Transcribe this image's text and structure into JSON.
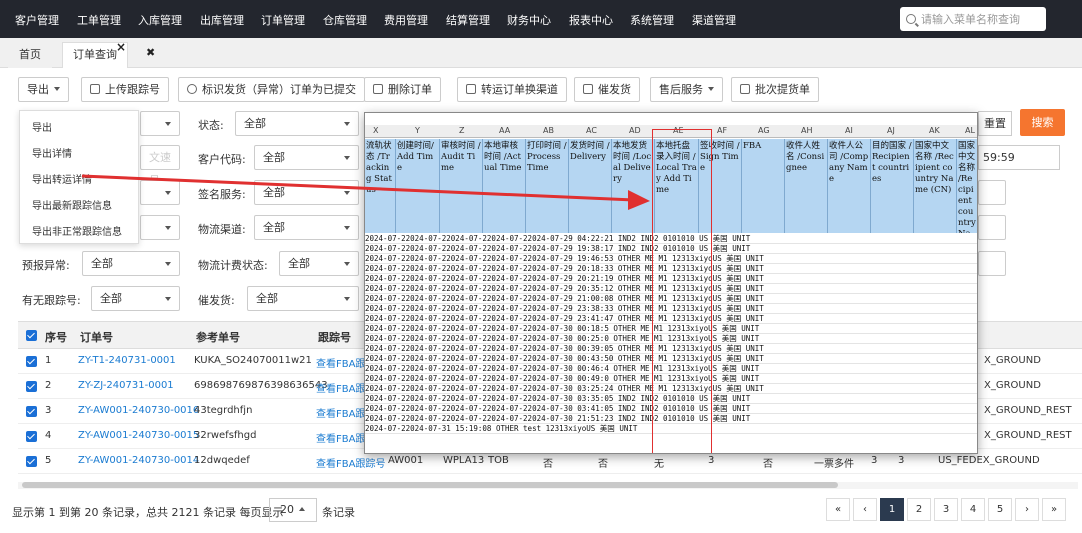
{
  "nav": {
    "items": [
      "客户管理",
      "工单管理",
      "入库管理",
      "出库管理",
      "订单管理",
      "仓库管理",
      "费用管理",
      "结算管理",
      "财务中心",
      "报表中心",
      "系统管理",
      "渠道管理"
    ],
    "search_placeholder": "请输入菜单名称查询"
  },
  "tabs": {
    "home": "首页",
    "order_query": "订单查询",
    "close_glyph": "×",
    "close_all_glyph": "✖"
  },
  "toolbar": {
    "export": "导出",
    "upload_tracking": "上传跟踪号",
    "mark_shipped": "标识发货（异常）订单为已提交",
    "delete_order": "删除订单",
    "transfer_channel": "转运订单换渠道",
    "urge_ship": "催发货",
    "after_sales": "售后服务",
    "batch_pickup": "批次提货单"
  },
  "export_menu": [
    "导出",
    "导出详情",
    "导出转运详情",
    "导出最新跟踪信息",
    "导出非正常跟踪信息"
  ],
  "filters": {
    "status_label": "状态:",
    "status_value": "全部",
    "customer_code_label": "客户代码:",
    "customer_code_value": "全部",
    "sign_service_label": "签名服务:",
    "sign_service_value": "全部",
    "logistics_channel_label": "物流渠道:",
    "logistics_channel_value": "全部",
    "forecast_abnormal_label": "预报异常:",
    "forecast_abnormal_value": "全部",
    "logistics_billing_label": "物流计费状态:",
    "logistics_billing_value": "全部",
    "has_tracking_label": "有无跟踪号:",
    "has_tracking_value": "全部",
    "urge_ship_label": "催发货:",
    "urge_ship_value": "全部",
    "faded_input": "文速号",
    "reset": "重置",
    "search": "搜索",
    "time_value": "59:59"
  },
  "table": {
    "headers": {
      "seq": "序号",
      "order_no": "订单号",
      "ref_no": "参考单号",
      "tracking": "跟踪号"
    },
    "rows": [
      {
        "seq": "1",
        "order_no": "ZY-T1-240731-0001",
        "ref_no": "KUKA_SO24070011w21",
        "tracking": "查看FBA跟踪",
        "tail": "X_GROUND"
      },
      {
        "seq": "2",
        "order_no": "ZY-ZJ-240731-0001",
        "ref_no": "698698769876398636543",
        "tracking": "查看FBA跟踪",
        "tail": "X_GROUND"
      },
      {
        "seq": "3",
        "order_no": "ZY-AW001-240730-0016",
        "ref_no": "43tegrdhfjn",
        "tracking": "查看FBA跟踪",
        "tail": "X_GROUND_REST"
      },
      {
        "seq": "4",
        "order_no": "ZY-AW001-240730-0015",
        "ref_no": "32rwefsfhgd",
        "tracking": "查看FBA跟踪",
        "tail": "X_GROUND_REST"
      },
      {
        "seq": "5",
        "order_no": "ZY-AW001-240730-0014",
        "ref_no": "12dwqedef",
        "tracking": "查看FBA跟踪号",
        "tail": "US_FEDEX_GROUND"
      }
    ],
    "row5_extra": [
      "AW001",
      "WPLA13",
      "TOB",
      "否",
      "否",
      "无",
      "3",
      "否",
      "一票多件",
      "3",
      "3"
    ]
  },
  "footer": {
    "summary": "显示第 1 到第 20 条记录，总共 2121 条记录 每页显示",
    "page_size": "20",
    "suffix": "条记录",
    "pages": [
      "«",
      "‹",
      "1",
      "2",
      "3",
      "4",
      "5",
      "›",
      "»"
    ],
    "active_page": "1"
  },
  "excel": {
    "columns": [
      "X",
      "Y",
      "Z",
      "AA",
      "AB",
      "AC",
      "AD",
      "AE",
      "AF",
      "AG",
      "AH",
      "AI",
      "AJ",
      "AK",
      "AL"
    ],
    "headers": [
      "流轨状态 /Tracking Status",
      "创建时间/Add Time",
      "审核时间 /Audit Time",
      "本地审核时间 /Actual Time",
      "打印时间 /Process Time",
      "发货时间 /Delivery",
      "本地发货时间 /Local Delivery",
      "本地托盘录入时间 /Local Tray Add Time",
      "签收时间 /Sign Time",
      "FBA",
      "收件人姓名 /Consignee",
      "收件人公司 /Company Name",
      "目的国家 /Recipient countries",
      "国家中文名称 /Recipient country Name (CN)",
      "国家中文名称 /Recipient country Name (EN)"
    ],
    "rows": [
      " 2024-07-22024-07-22024-07-22024-07-22024-07-29 04:22:21       IND2    IND2    0101010  US     美国     UNIT",
      " 2024-07-22024-07-22024-07-22024-07-22024-07-29 19:38:17       IND2    IND2    0101010  US     美国     UNIT",
      " 2024-07-22024-07-22024-07-22024-07-22024-07-29 19:46:53       OTHER   ME M1   12313xiyoUS     美国     UNIT",
      " 2024-07-22024-07-22024-07-22024-07-22024-07-29 20:18:33       OTHER   ME M1   12313xiyoUS     美国     UNIT",
      " 2024-07-22024-07-22024-07-22024-07-22024-07-29 20:21:19       OTHER   ME M1   12313xiyoUS     美国     UNIT",
      " 2024-07-22024-07-22024-07-22024-07-22024-07-29 20:35:12       OTHER   ME M1   12313xiyoUS     美国     UNIT",
      " 2024-07-22024-07-22024-07-22024-07-22024-07-29 21:00:08       OTHER   ME M1   12313xiyoUS     美国     UNIT",
      " 2024-07-22024-07-22024-07-22024-07-22024-07-29 23:38:33       OTHER   ME M1   12313xiyoUS     美国     UNIT",
      " 2024-07-22024-07-22024-07-22024-07-22024-07-29 23:41:47       OTHER   ME M1   12313xiyoUS     美国     UNIT",
      " 2024-07-22024-07-22024-07-22024-07-22024-07-30 00:18:5 OTHER   ME M1   12313xiyoUS     美国     UNIT",
      " 2024-07-22024-07-22024-07-22024-07-22024-07-30 00:25:0 OTHER   ME M1   12313xiyoUS     美国     UNIT",
      " 2024-07-22024-07-22024-07-22024-07-22024-07-30 00:39:05       OTHER   ME M1   12313xiyoUS     美国     UNIT",
      " 2024-07-22024-07-22024-07-22024-07-22024-07-30 00:43:50       OTHER   ME M1   12313xiyoUS     美国     UNIT",
      " 2024-07-22024-07-22024-07-22024-07-22024-07-30 00:46:4 OTHER   ME M1   12313xiyoUS     美国     UNIT",
      " 2024-07-22024-07-22024-07-22024-07-22024-07-30 00:49:0 OTHER   ME M1   12313xiyoUS     美国     UNIT",
      " 2024-07-22024-07-22024-07-22024-07-22024-07-30 03:25:24       OTHER   ME M1   12313xiyoUS     美国     UNIT",
      " 2024-07-22024-07-22024-07-22024-07-22024-07-30 03:35:05       IND2    IND2    0101010  US     美国     UNIT",
      " 2024-07-22024-07-22024-07-22024-07-22024-07-30 03:41:05       IND2    IND2    0101010  US     美国     UNIT",
      " 2024-07-22024-07-22024-07-22024-07-22024-07-30 21:51:23       IND2    IND2    0101010  US     美国     UNIT",
      " 2024-07-22024-07-31 15:19:08                                  OTHER   test    12313xiyoUS     美国     UNIT"
    ]
  },
  "colors": {
    "nav_bg": "#23262e",
    "search_btn": "#f5752f",
    "link": "#1a7bd1",
    "excel_header": "#b5d6f2",
    "arrow": "#e03030"
  }
}
